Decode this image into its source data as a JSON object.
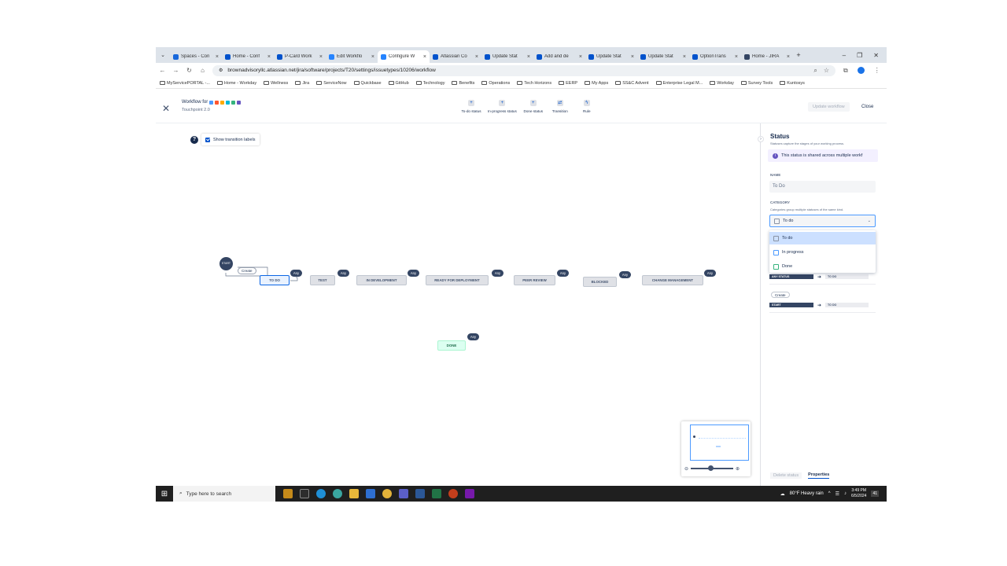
{
  "browser": {
    "tabs": [
      {
        "label": "Spaces - Con",
        "icon_color": "#1868db",
        "active": false
      },
      {
        "label": "Home - Conf",
        "icon_color": "#0052cc",
        "active": false
      },
      {
        "label": "P-Card Work",
        "icon_color": "#0052cc",
        "active": false
      },
      {
        "label": "Edit Workflo",
        "icon_color": "#2684ff",
        "active": false
      },
      {
        "label": "Configure W",
        "icon_color": "#2684ff",
        "active": true
      },
      {
        "label": "Atlassian Co",
        "icon_color": "#0052cc",
        "active": false
      },
      {
        "label": "Update Stat",
        "icon_color": "#0052cc",
        "active": false
      },
      {
        "label": "Add and de",
        "icon_color": "#0052cc",
        "active": false
      },
      {
        "label": "Update Stat",
        "icon_color": "#0052cc",
        "active": false
      },
      {
        "label": "Update Stat",
        "icon_color": "#0052cc",
        "active": false
      },
      {
        "label": "OptionTrans",
        "icon_color": "#0052cc",
        "active": false
      },
      {
        "label": "Home - JIRA",
        "icon_color": "#344563",
        "active": false
      }
    ],
    "url": "brownadvisoryllc.atlassian.net/jira/software/projects/T20/settings/issuetypes/10206/workflow",
    "bookmarks": [
      "MyServicePORTAL -...",
      "Home - Workday",
      "Wellness",
      "Jira",
      "ServiceNow",
      "Quickbase",
      "GitHub",
      "Technology",
      "Benefits",
      "Operations",
      "Tech Horizons",
      "EERP",
      "My Apps",
      "SS&C Advent",
      "Enterprise Legal M...",
      "Workday",
      "Survey Tools",
      "Kuntosys"
    ]
  },
  "header": {
    "title": "Workflow for",
    "subtitle": "Touchpoint 2.0",
    "tools": [
      {
        "label": "To-do status",
        "icon": "+"
      },
      {
        "label": "In-progress status",
        "icon": "+"
      },
      {
        "label": "Done status",
        "icon": "+"
      },
      {
        "label": "Transition",
        "icon": "⇄"
      },
      {
        "label": "Rule",
        "icon": "ϟ"
      }
    ],
    "update_label": "Update workflow",
    "close_label": "Close"
  },
  "canvas": {
    "show_labels": "Show transition labels",
    "start_label": "START",
    "create_label": "Create",
    "any_label": "Any",
    "statuses": [
      "TO DO",
      "TEST",
      "IN DEVELOPMENT",
      "READY FOR DEPLOYMENT",
      "PEER REVIEW",
      "BLOCKED",
      "CHANGE MANAGEMENT"
    ],
    "done_status": "DONE"
  },
  "panel": {
    "title": "Status",
    "description": "Statuses capture the stages of your working process.",
    "shared_notice": "This status is shared across multiple workf",
    "name_label": "NAME",
    "name_value": "To Do",
    "category_label": "CATEGORY",
    "category_hint": "Categories group multiple statuses of the same kind.",
    "category_value": "To do",
    "options": [
      "To do",
      "In progress",
      "Done"
    ],
    "transition1_from": "ANY STATUS",
    "transition1_to": "TO DO",
    "create_tag": "Create",
    "transition2_from": "START",
    "transition2_to": "TO DO",
    "delete_label": "Delete status",
    "properties_label": "Properties"
  },
  "taskbar": {
    "search_placeholder": "Type here to search",
    "weather": "80°F  Heavy rain",
    "time": "3:49 PM",
    "date": "6/5/2024",
    "notifications": "41"
  }
}
